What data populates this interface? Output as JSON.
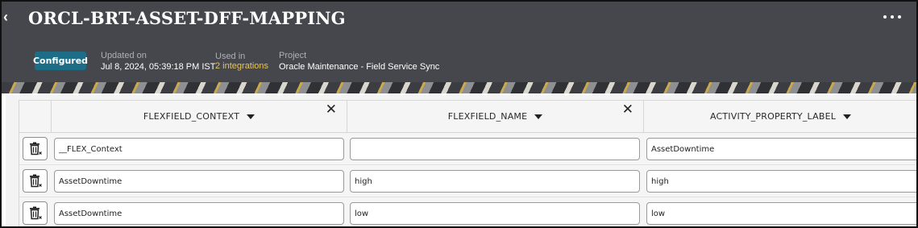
{
  "header": {
    "title": "ORCL-BRT-ASSET-DFF-MAPPING",
    "status_badge": "Configured",
    "updated_label": "Updated on",
    "updated_value": "Jul 8, 2024, 05:39:18 PM IST",
    "used_in_label": "Used in",
    "used_in_value": "2 integrations",
    "project_label": "Project",
    "project_value": "Oracle Maintenance - Field Service Sync",
    "icons": [
      "back-arrow-icon",
      "more-options-icon"
    ]
  },
  "table": {
    "columns": [
      {
        "label": "FLEXFIELD_CONTEXT",
        "closable": true
      },
      {
        "label": "FLEXFIELD_NAME",
        "closable": true
      },
      {
        "label": "ACTIVITY_PROPERTY_LABEL",
        "closable": false
      }
    ],
    "rows": [
      [
        "__FLEX_Context",
        "",
        "AssetDowntime"
      ],
      [
        "AssetDowntime",
        "high",
        "high"
      ],
      [
        "AssetDowntime",
        "low",
        "low"
      ]
    ],
    "row_action_icon": "trash-icon"
  },
  "colors": {
    "header_bg": "#45474c",
    "badge_bg": "#1d6d86",
    "link": "#e7c45a"
  }
}
